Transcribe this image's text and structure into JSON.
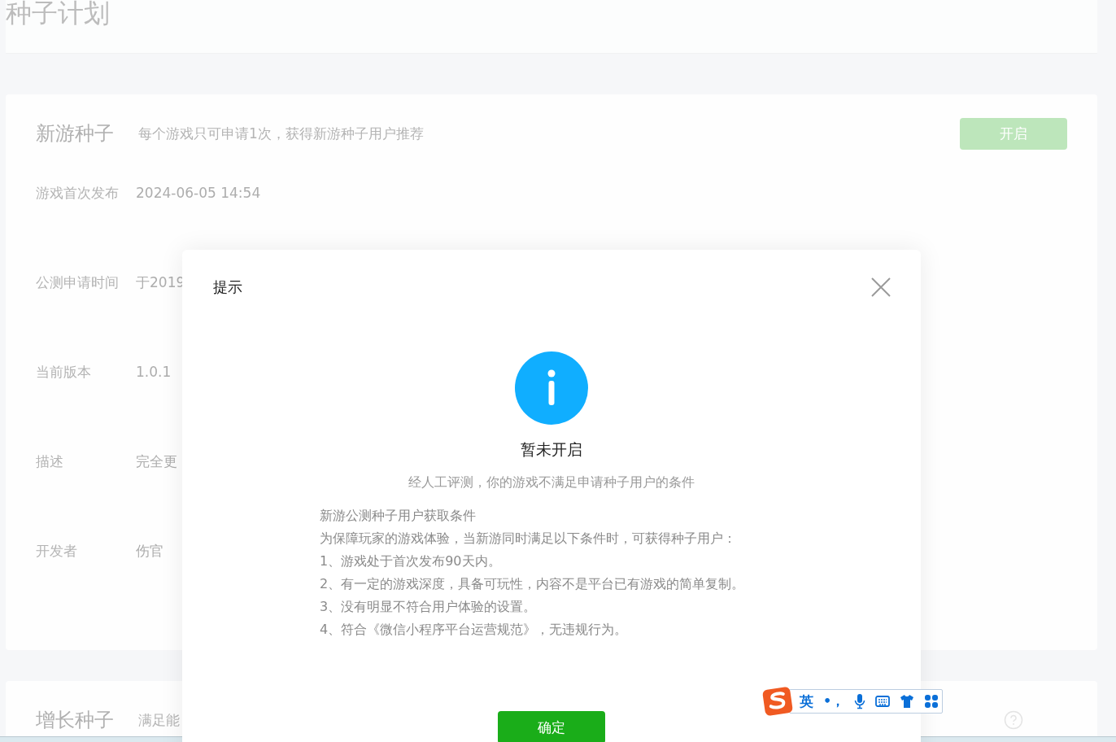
{
  "page": {
    "title": "种子计划"
  },
  "sections": [
    {
      "title": "新游种子",
      "subtitle": "每个游戏只可申请1次，获得新游种子用户推荐",
      "help": false,
      "button": {
        "label": "开启"
      },
      "fields": [
        {
          "label": "游戏首次发布",
          "value": "2024-06-05 14:54"
        },
        {
          "label": "公测申请时间",
          "value": "于2019"
        },
        {
          "label": "当前版本",
          "value": "1.0.1"
        },
        {
          "label": "描述",
          "value": "完全更"
        },
        {
          "label": "开发者",
          "value": "伤官"
        }
      ]
    },
    {
      "title": "增长种子",
      "subtitle": "满足能",
      "help": true
    }
  ],
  "dialog": {
    "title": "提示",
    "heading": "暂未开启",
    "message": "经人工评测，你的游戏不满足申请种子用户的条件",
    "details": [
      "新游公测种子用户获取条件",
      "为保障玩家的游戏体验，当新游同时满足以下条件时，可获得种子用户：",
      "1、游戏处于首次发布90天内。",
      "2、有一定的游戏深度，具备可玩性，内容不是平台已有游戏的简单复制。",
      "3、没有明显不符合用户体验的设置。",
      "4、符合《微信小程序平台运营规范》，无违规行为。"
    ],
    "confirm": "确定"
  },
  "ime_toolbar": {
    "mode": "英",
    "punctuation": "•，"
  }
}
